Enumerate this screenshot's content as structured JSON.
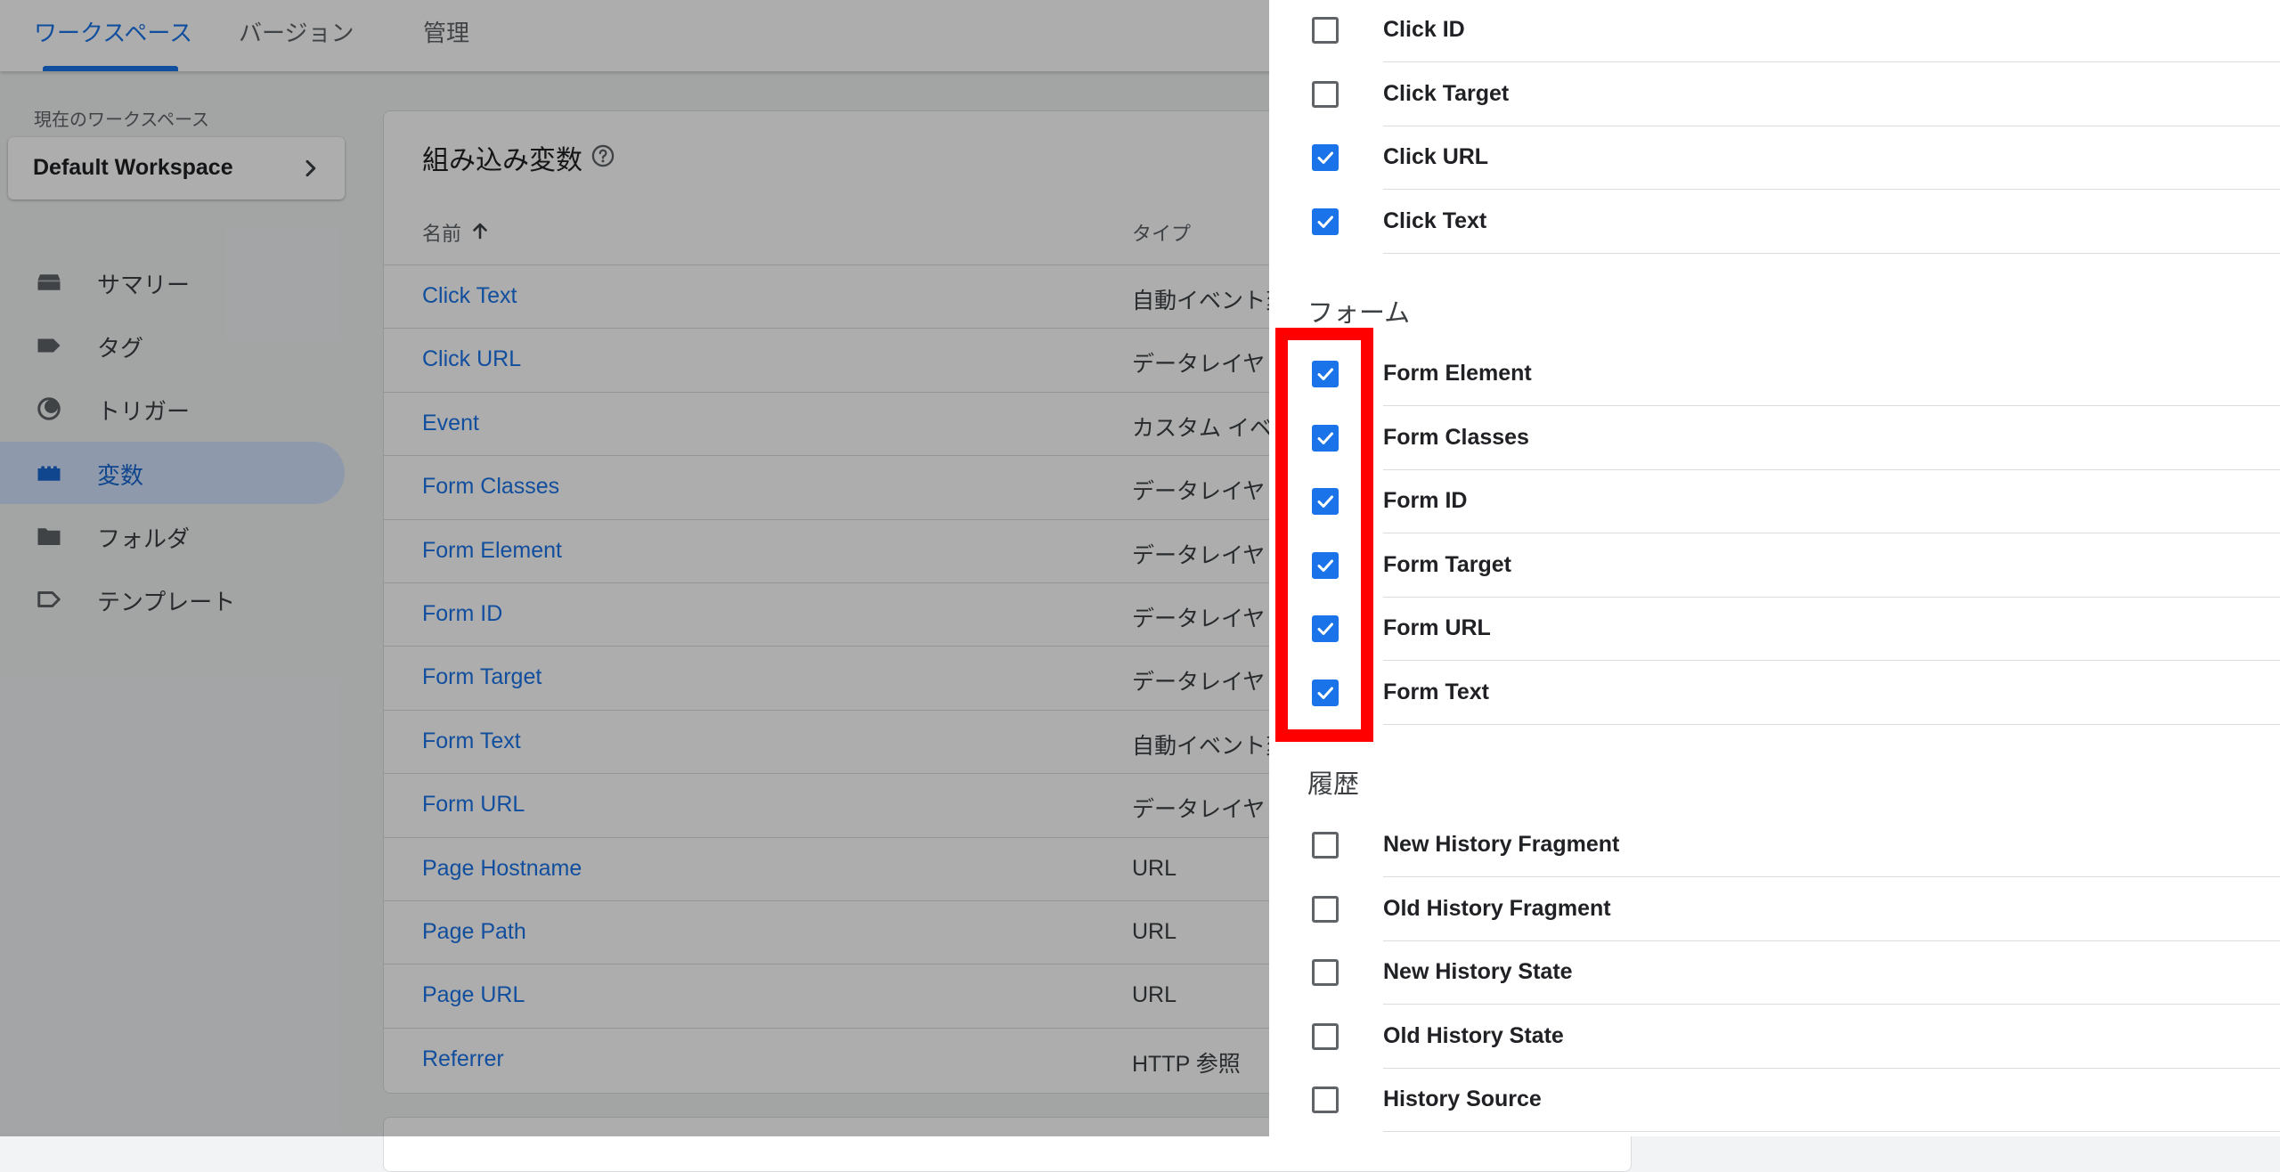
{
  "header": {
    "tabs": [
      {
        "label": "ワークスペース",
        "active": true
      },
      {
        "label": "バージョン",
        "active": false
      },
      {
        "label": "管理",
        "active": false
      }
    ]
  },
  "sidebar": {
    "workspace_label": "現在のワークスペース",
    "workspace_name": "Default Workspace",
    "items": [
      {
        "label": "サマリー",
        "icon": "inbox-icon",
        "active": false
      },
      {
        "label": "タグ",
        "icon": "tag-icon",
        "active": false
      },
      {
        "label": "トリガー",
        "icon": "trigger-icon",
        "active": false
      },
      {
        "label": "変数",
        "icon": "variables-icon",
        "active": true
      },
      {
        "label": "フォルダ",
        "icon": "folder-icon",
        "active": false
      },
      {
        "label": "テンプレート",
        "icon": "template-icon",
        "active": false
      }
    ]
  },
  "main": {
    "title": "組み込み変数",
    "columns": {
      "name": "名前",
      "type": "タイプ"
    },
    "rows": [
      {
        "name": "Click Text",
        "type": "自動イベント変"
      },
      {
        "name": "Click URL",
        "type": "データレイヤ"
      },
      {
        "name": "Event",
        "type": "カスタム イベ"
      },
      {
        "name": "Form Classes",
        "type": "データレイヤ"
      },
      {
        "name": "Form Element",
        "type": "データレイヤ"
      },
      {
        "name": "Form ID",
        "type": "データレイヤ"
      },
      {
        "name": "Form Target",
        "type": "データレイヤ"
      },
      {
        "name": "Form Text",
        "type": "自動イベント変"
      },
      {
        "name": "Form URL",
        "type": "データレイヤ"
      },
      {
        "name": "Page Hostname",
        "type": "URL"
      },
      {
        "name": "Page Path",
        "type": "URL"
      },
      {
        "name": "Page URL",
        "type": "URL"
      },
      {
        "name": "Referrer",
        "type": "HTTP 参照"
      }
    ]
  },
  "panel": {
    "click_items": [
      {
        "label": "Click ID",
        "checked": false
      },
      {
        "label": "Click Target",
        "checked": false
      },
      {
        "label": "Click URL",
        "checked": true
      },
      {
        "label": "Click Text",
        "checked": true
      }
    ],
    "form_heading": "フォーム",
    "form_items": [
      {
        "label": "Form Element",
        "checked": true
      },
      {
        "label": "Form Classes",
        "checked": true
      },
      {
        "label": "Form ID",
        "checked": true
      },
      {
        "label": "Form Target",
        "checked": true
      },
      {
        "label": "Form URL",
        "checked": true
      },
      {
        "label": "Form Text",
        "checked": true
      }
    ],
    "history_heading": "履歴",
    "history_items": [
      {
        "label": "New History Fragment",
        "checked": false
      },
      {
        "label": "Old History Fragment",
        "checked": false
      },
      {
        "label": "New History State",
        "checked": false
      },
      {
        "label": "Old History State",
        "checked": false
      },
      {
        "label": "History Source",
        "checked": false
      }
    ]
  },
  "colors": {
    "accent": "#1a73e8",
    "highlight": "#ff0000",
    "nav_active_bg": "#d2e3fc"
  }
}
